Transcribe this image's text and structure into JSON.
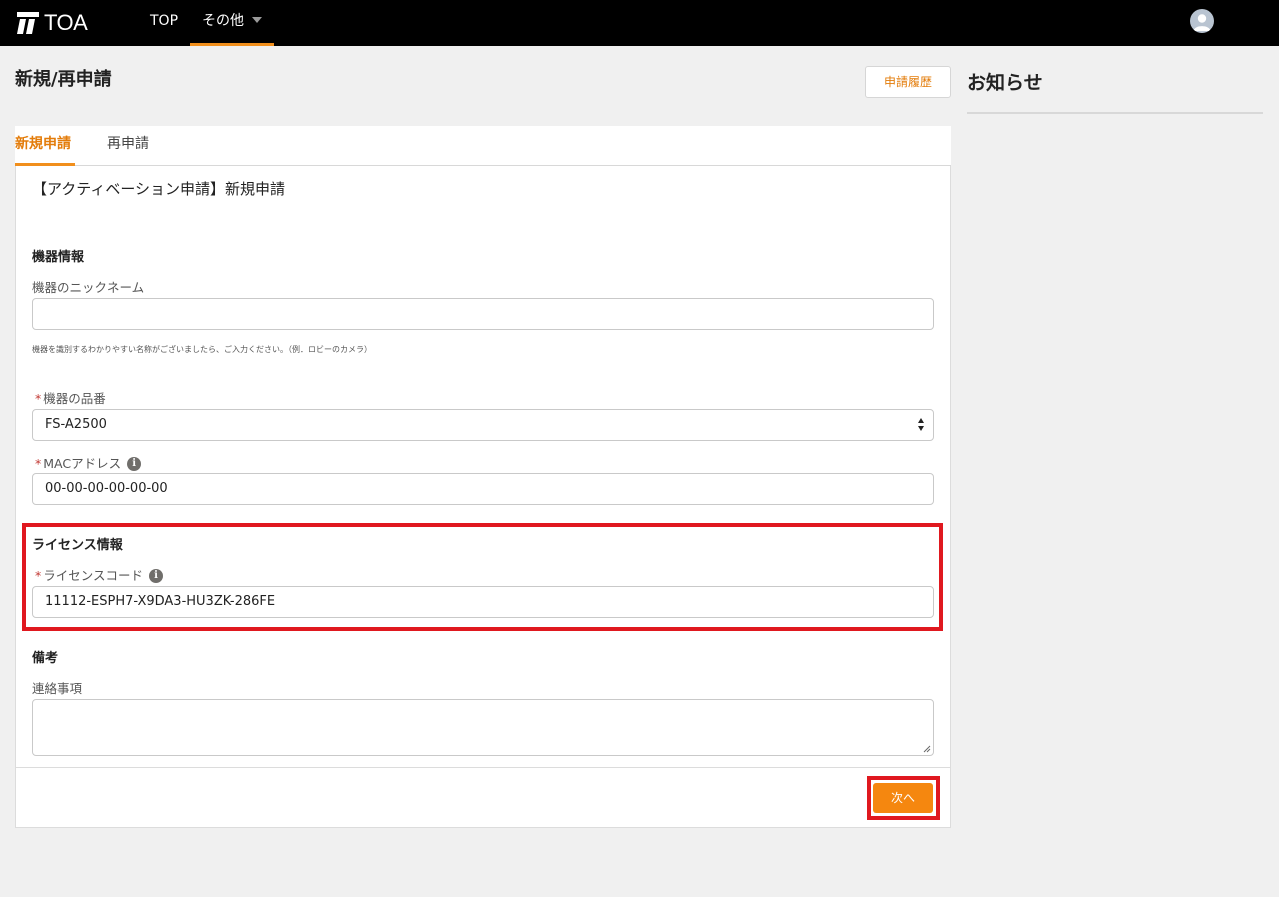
{
  "header": {
    "logo_text": "TOA",
    "nav": [
      {
        "label": "TOP"
      },
      {
        "label": "その他"
      }
    ]
  },
  "page": {
    "title": "新規/再申請",
    "history_button": "申請履歴"
  },
  "notice": {
    "title": "お知らせ"
  },
  "tabs": [
    {
      "label": "新規申請",
      "active": true
    },
    {
      "label": "再申請",
      "active": false
    }
  ],
  "form": {
    "title": "【アクティベーション申請】新規申請",
    "device_section": "機器情報",
    "nickname": {
      "label": "機器のニックネーム",
      "value": "",
      "helper": "機器を識別するわかりやすい名称がございましたら、ご入力ください。（例．ロビーのカメラ）"
    },
    "model": {
      "label": "機器の品番",
      "value": "FS-A2500"
    },
    "mac": {
      "label": "MACアドレス",
      "value": "00-00-00-00-00-00"
    },
    "license_section": "ライセンス情報",
    "license_code": {
      "label": "ライセンスコード",
      "value": "11112-ESPH7-X9DA3-HU3ZK-286FE"
    },
    "remarks_section": "備考",
    "contact": {
      "label": "連絡事項",
      "value": ""
    },
    "required_mark": "*",
    "info_mark": "i",
    "next_button": "次へ"
  },
  "colors": {
    "accent": "#f18f1c",
    "highlight": "#e0181f",
    "topbar": "#000000"
  }
}
